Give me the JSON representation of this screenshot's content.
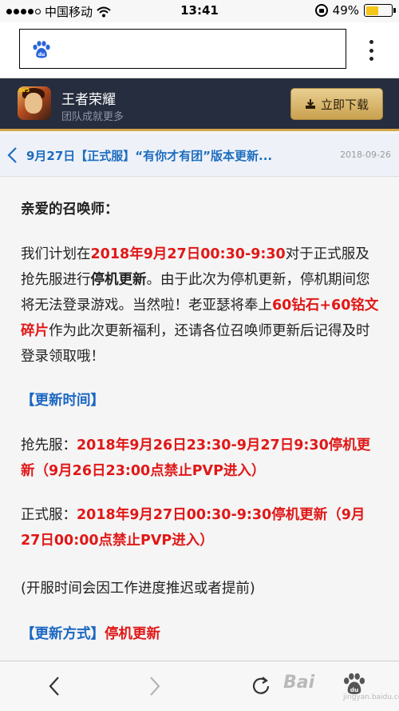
{
  "status_bar": {
    "carrier": "中国移动",
    "time": "13:41",
    "battery_percent": "49%",
    "battery_level": 0.49,
    "battery_color": "#f5c518"
  },
  "address_bar": {
    "logo_icon": "baidu-paw-icon",
    "menu_icon": "more-vertical-icon"
  },
  "game_banner": {
    "title": "王者荣耀",
    "subtitle": "团队成就更多",
    "download_label": "立即下载",
    "background_color": "#262d3e",
    "accent_color": "#d3a648"
  },
  "article": {
    "title": "9月27日【正式服】“有你才有团”版本更新...",
    "date": "2018-09-26"
  },
  "content": {
    "greeting": "亲爱的召唤师：",
    "intro": {
      "t1": " 我们计划在",
      "t2": "2018年9月27日00:30-9:30",
      "t3": "对于正式服及抢先服进行",
      "t4": "停机更新",
      "t5": "。由于此次为停机更新，停机期间您将无法登录游戏。当然啦！老亚瑟将奉上",
      "t6": "60钻石+60铭文碎片",
      "t7": "作为此次更新福利，还请各位召唤师更新后记得及时登录领取哦！"
    },
    "section_time": "【更新时间】",
    "preview_server": {
      "label": "抢先服：",
      "value": "2018年9月26日23:30-9月27日9:30停机更新（9月26日23:00点禁止PVP进入）"
    },
    "official_server": {
      "label": "正式服：",
      "value": "2018年9月27日00:30-9:30停机更新（9月27日00:00点禁止PVP进入）"
    },
    "note": "(开服时间会因工作进度推迟或者提前)",
    "section_method": {
      "label": "【更新方式】",
      "value": "停机更新"
    },
    "highlight_red": "#e01818",
    "highlight_blue": "#1a66c2"
  },
  "bottom_bar": {
    "back_icon": "chevron-left-icon",
    "forward_icon": "chevron-right-icon",
    "reload_icon": "reload-icon",
    "watermark": "Bai",
    "watermark_sub": "jingyan.baidu.com"
  }
}
